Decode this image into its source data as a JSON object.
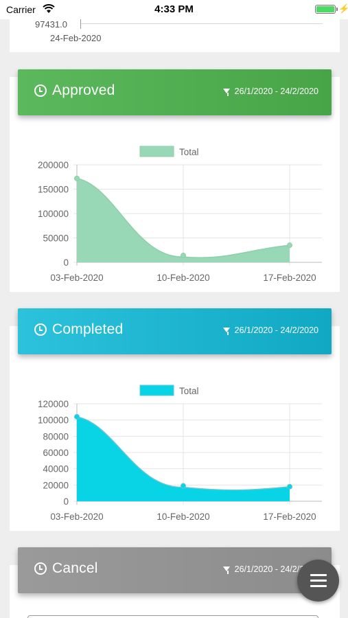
{
  "status_bar": {
    "carrier": "Carrier",
    "time": "4:33 PM"
  },
  "top_chart": {
    "tick_value": "97431.0",
    "x_label": "24-Feb-2020"
  },
  "sections": {
    "approved": {
      "title": "Approved",
      "range": "26/1/2020 - 24/2/2020",
      "color": "#5cb85c"
    },
    "completed": {
      "title": "Completed",
      "range": "26/1/2020 - 24/2/2020",
      "color": "#1ab6d0"
    },
    "cancel": {
      "title": "Cancel",
      "range": "26/1/2020 - 24/2/2020",
      "color": "#999999"
    }
  },
  "chart_data": [
    {
      "type": "area",
      "categories": [
        "03-Feb-2020",
        "10-Feb-2020",
        "17-Feb-2020"
      ],
      "series": [
        {
          "name": "Total",
          "values": [
            172000,
            14000,
            35000
          ],
          "color": "#99d8b6",
          "line": "#8ccfa9"
        }
      ],
      "y_ticks": [
        "0",
        "50000",
        "100000",
        "150000",
        "200000"
      ],
      "ylim": [
        0,
        200000
      ],
      "legend": "top-center",
      "grid": true
    },
    {
      "type": "area",
      "categories": [
        "03-Feb-2020",
        "10-Feb-2020",
        "17-Feb-2020"
      ],
      "series": [
        {
          "name": "Total",
          "values": [
            104000,
            19000,
            18000
          ],
          "color": "#08d4e6",
          "line": "#5ec8d4"
        }
      ],
      "y_ticks": [
        "0",
        "20000",
        "40000",
        "60000",
        "80000",
        "100000",
        "120000"
      ],
      "ylim": [
        0,
        120000
      ],
      "legend": "top-center",
      "grid": true
    }
  ]
}
